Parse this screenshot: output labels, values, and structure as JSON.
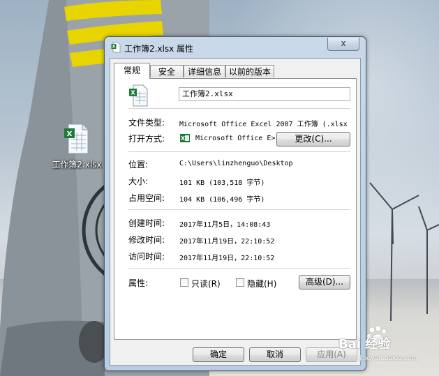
{
  "colors": {
    "accent_yellow": "#e8d500",
    "excel_green": "#1f7a3a",
    "title_blue": "#c9d9ea"
  },
  "desktop": {
    "icon_label": "工作簿2.xlsx"
  },
  "dialog": {
    "title": "工作簿2.xlsx 属性",
    "close_label": "x",
    "tabs": [
      "常规",
      "安全",
      "详细信息",
      "以前的版本"
    ],
    "filename": "工作簿2.xlsx",
    "file_type_label": "文件类型:",
    "file_type_value": "Microsoft Office Excel 2007 工作簿 (.xlsx",
    "open_with_label": "打开方式:",
    "open_with_value": "Microsoft Office E>",
    "change_button": "更改(C)...",
    "location_label": "位置:",
    "location_value": "C:\\Users\\linzhenguo\\Desktop",
    "size_label": "大小:",
    "size_value": "101 KB (103,518 字节)",
    "disk_size_label": "占用空间:",
    "disk_size_value": "104 KB (106,496 字节)",
    "created_label": "创建时间:",
    "created_value": "2017年11月5日，14:08:43",
    "modified_label": "修改时间:",
    "modified_value": "2017年11月19日，22:10:52",
    "accessed_label": "访问时间:",
    "accessed_value": "2017年11月19日，22:10:52",
    "attributes_label": "属性:",
    "readonly_label": "只读(R)",
    "hidden_label": "隐藏(H)",
    "advanced_button": "高级(D)...",
    "ok_button": "确定",
    "cancel_button": "取消",
    "apply_button": "应用(A)"
  },
  "watermark": {
    "text": "Bai 经验",
    "sub": "jingyan.baidu.com"
  }
}
